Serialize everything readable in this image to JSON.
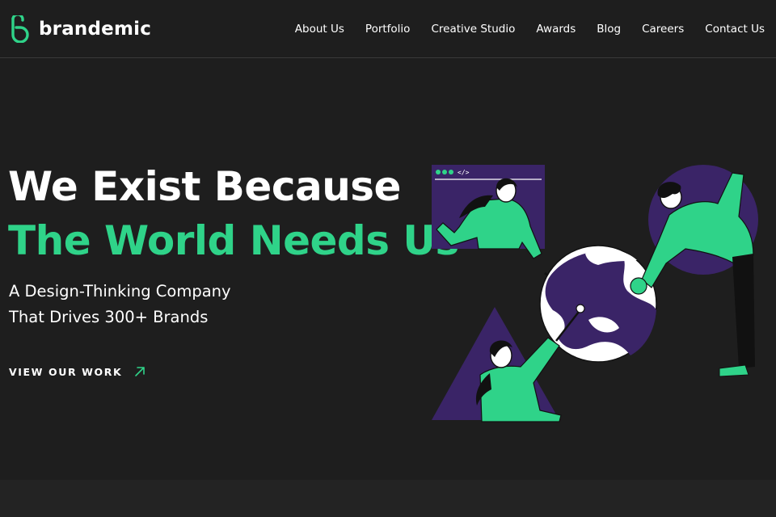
{
  "header": {
    "logo_text": "brandemic",
    "nav": [
      {
        "label": "About Us"
      },
      {
        "label": "Portfolio"
      },
      {
        "label": "Creative Studio"
      },
      {
        "label": "Awards"
      },
      {
        "label": "Blog"
      },
      {
        "label": "Careers"
      },
      {
        "label": "Contact Us"
      }
    ]
  },
  "hero": {
    "title_line1": "We Exist Because",
    "title_line2": "The World Needs Us",
    "subtitle_line1": "A Design-Thinking Company",
    "subtitle_line2": "That Drives 300+ Brands",
    "cta_label": "VIEW OUR WORK",
    "cta_icon": "arrow-up-right-icon"
  },
  "illustration": {
    "window_code_tag": "</>"
  },
  "colors": {
    "background": "#1e1e1e",
    "accent_green": "#2fd389",
    "illustration_purple": "#3a2467",
    "text": "#ffffff"
  }
}
